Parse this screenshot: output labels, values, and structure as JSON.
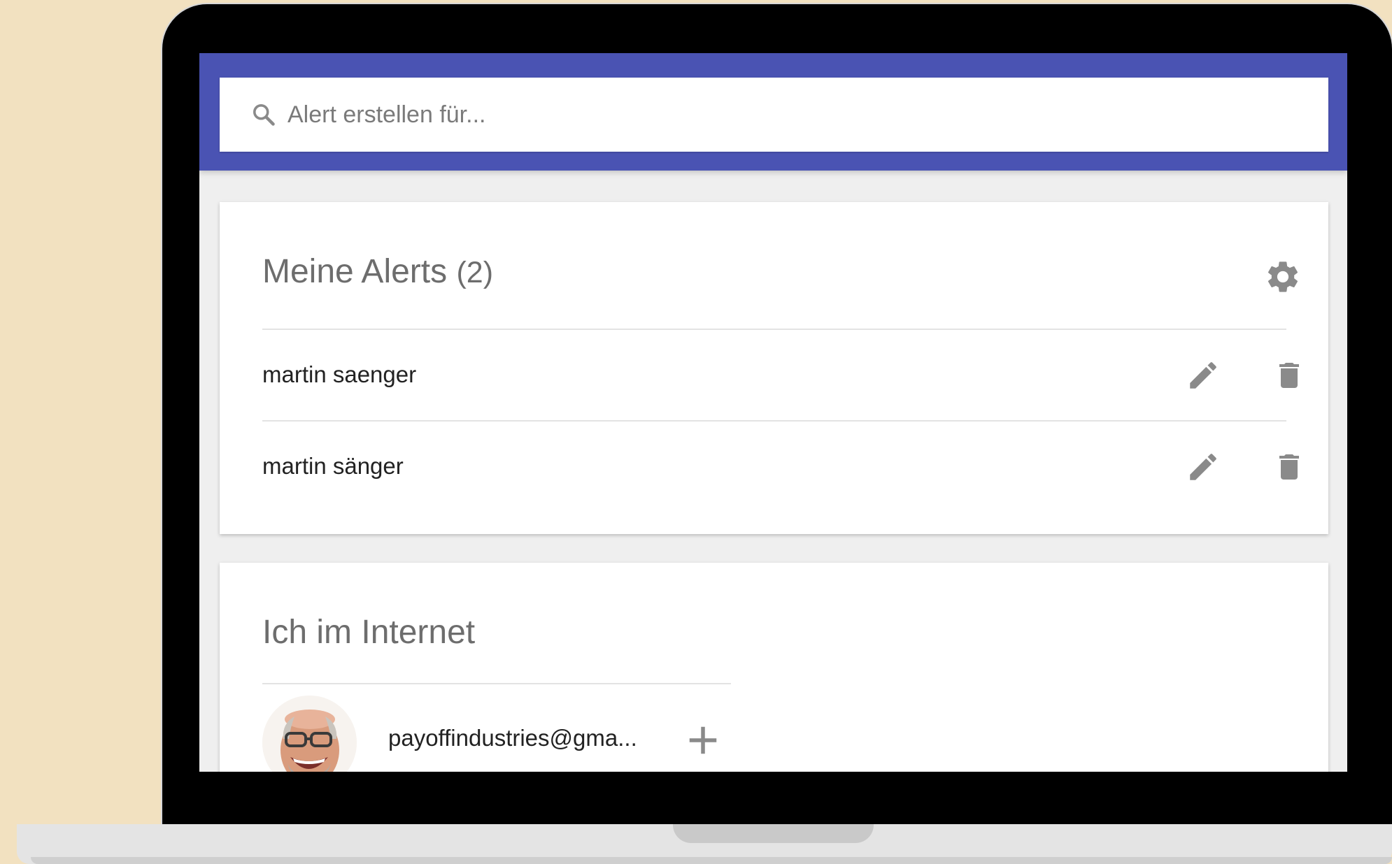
{
  "search": {
    "placeholder": "Alert erstellen für..."
  },
  "alerts": {
    "title": "Meine Alerts",
    "count": "(2)",
    "items": [
      {
        "label": "martin saenger"
      },
      {
        "label": "martin sänger"
      }
    ]
  },
  "internet": {
    "title": "Ich im Internet",
    "account": {
      "email": "payoffindustries@gma..."
    }
  },
  "colors": {
    "background": "#f2e1c0",
    "header": "#4a53b3",
    "icon": "#8a8a8a"
  },
  "icons": [
    "search-icon",
    "gear-icon",
    "pencil-icon",
    "trash-icon",
    "plus-icon"
  ]
}
